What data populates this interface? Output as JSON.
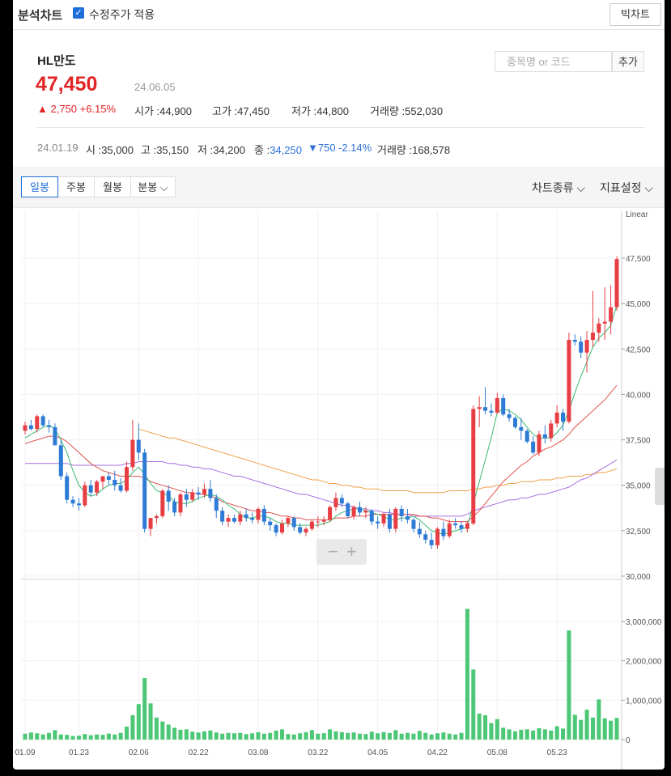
{
  "topbar": {
    "title": "분석차트",
    "adjusted_label": "수정주가 적용",
    "big_chart_label": "빅차트"
  },
  "stock": {
    "name": "HL만도",
    "price": "47,450",
    "date": "24.06.05",
    "change": "▲ 2,750  +6.15%",
    "open_label": "시가 :",
    "open": "44,900",
    "high_label": "고가 :",
    "high": "47,450",
    "low_label": "저가 :",
    "low": "44,800",
    "volume_label": "거래량 :",
    "volume": "552,030"
  },
  "search": {
    "placeholder": "종목명 or 코드",
    "add_label": "추가"
  },
  "hover": {
    "date": "24.01.19",
    "open_label": "시 :",
    "open": "35,000",
    "high_label": "고 :",
    "high": "35,150",
    "low_label": "저 :",
    "low": "34,200",
    "close_label": "종 :",
    "close": "34,250",
    "change": "▼750",
    "pct": "-2.14%",
    "volume_label": "거래량 :",
    "volume": "168,578"
  },
  "tabs": [
    "일봉",
    "주봉",
    "월봉",
    "분봉"
  ],
  "active_tab": "일봉",
  "selectors": {
    "chart_type": "차트종류",
    "indicator": "지표설정"
  },
  "colors": {
    "up": "#e63e44",
    "down": "#2d7bd6",
    "ma5": "#3cb971",
    "ma20": "#e05252",
    "ma60": "#a96ee0",
    "ma120": "#f0a24a",
    "volume": "#4bc775"
  },
  "chart_data": {
    "type": "candlestick",
    "scale_label": "Linear",
    "price_axis": {
      "min": 30000,
      "max": 47500,
      "ticks": [
        "30,000",
        "32,500",
        "35,000",
        "37,500",
        "40,000",
        "42,500",
        "45,000",
        "47,500"
      ]
    },
    "volume_axis": {
      "min": 0,
      "max": 3000000,
      "ticks": [
        "0",
        "1,000,000",
        "2,000,000",
        "3,000,000"
      ]
    },
    "x_ticks": [
      {
        "label": "01.09",
        "i": 0
      },
      {
        "label": "01.23",
        "i": 9
      },
      {
        "label": "02.06",
        "i": 19
      },
      {
        "label": "02.22",
        "i": 29
      },
      {
        "label": "03.08",
        "i": 39
      },
      {
        "label": "03.22",
        "i": 49
      },
      {
        "label": "04.05",
        "i": 59
      },
      {
        "label": "04.22",
        "i": 69
      },
      {
        "label": "05.08",
        "i": 79
      },
      {
        "label": "05.23",
        "i": 89
      }
    ],
    "candles": [
      [
        38000,
        38500,
        37800,
        38300
      ],
      [
        38300,
        38600,
        38000,
        38100
      ],
      [
        38100,
        38900,
        37900,
        38800
      ],
      [
        38800,
        38900,
        38200,
        38300
      ],
      [
        38300,
        38600,
        37900,
        38200
      ],
      [
        38200,
        38400,
        37200,
        37200
      ],
      [
        37200,
        37500,
        35300,
        35500
      ],
      [
        35500,
        35700,
        34000,
        34200
      ],
      [
        34200,
        34400,
        33800,
        34000
      ],
      [
        34000,
        34300,
        33600,
        33900
      ],
      [
        33900,
        35200,
        33800,
        35000
      ],
      [
        35000,
        35300,
        34400,
        34600
      ],
      [
        34600,
        35300,
        34400,
        35200
      ],
      [
        35200,
        35500,
        34800,
        35500
      ],
      [
        35500,
        35700,
        35000,
        35300
      ],
      [
        35300,
        35800,
        34700,
        35000
      ],
      [
        35000,
        35400,
        34600,
        34700
      ],
      [
        34700,
        36300,
        34600,
        36000
      ],
      [
        36000,
        38600,
        35800,
        37500
      ],
      [
        37500,
        38400,
        36400,
        36800
      ],
      [
        36800,
        37000,
        32400,
        32600
      ],
      [
        32600,
        33000,
        32200,
        33200
      ],
      [
        33200,
        33400,
        32900,
        33300
      ],
      [
        33300,
        34800,
        33200,
        34700
      ],
      [
        34700,
        35000,
        33600,
        34100
      ],
      [
        34100,
        34300,
        33300,
        33500
      ],
      [
        33500,
        34600,
        33300,
        34500
      ],
      [
        34500,
        34800,
        33800,
        34200
      ],
      [
        34200,
        34800,
        34100,
        34600
      ],
      [
        34600,
        34900,
        34200,
        34500
      ],
      [
        34500,
        35100,
        34300,
        34800
      ],
      [
        34800,
        35300,
        34100,
        34300
      ],
      [
        34300,
        34500,
        33200,
        33600
      ],
      [
        33600,
        33800,
        32800,
        33000
      ],
      [
        33000,
        33400,
        32700,
        33200
      ],
      [
        33200,
        33400,
        32900,
        33000
      ],
      [
        33000,
        33600,
        32800,
        33400
      ],
      [
        33400,
        33700,
        33000,
        33200
      ],
      [
        33200,
        33500,
        32900,
        33100
      ],
      [
        33100,
        33800,
        32900,
        33700
      ],
      [
        33700,
        33900,
        32800,
        33000
      ],
      [
        33000,
        33200,
        32500,
        32800
      ],
      [
        32800,
        32900,
        32200,
        32400
      ],
      [
        32400,
        33100,
        32300,
        32900
      ],
      [
        32900,
        33300,
        32700,
        33200
      ],
      [
        33200,
        33300,
        32500,
        32700
      ],
      [
        32700,
        32900,
        32300,
        32400
      ],
      [
        32400,
        32700,
        32200,
        32600
      ],
      [
        32600,
        33100,
        32500,
        33000
      ],
      [
        33000,
        33300,
        32700,
        33000
      ],
      [
        33000,
        33300,
        32800,
        33100
      ],
      [
        33100,
        33900,
        33000,
        33800
      ],
      [
        33800,
        34600,
        33600,
        34300
      ],
      [
        34300,
        34500,
        33800,
        34000
      ],
      [
        34000,
        34100,
        33200,
        33300
      ],
      [
        33300,
        33900,
        33100,
        33800
      ],
      [
        33800,
        34100,
        33300,
        33500
      ],
      [
        33500,
        33800,
        33200,
        33600
      ],
      [
        33600,
        33700,
        32800,
        33000
      ],
      [
        33000,
        33300,
        32600,
        32900
      ],
      [
        32900,
        33500,
        32700,
        33400
      ],
      [
        33400,
        33700,
        32400,
        32600
      ],
      [
        32600,
        33800,
        32400,
        33700
      ],
      [
        33700,
        33900,
        33000,
        33300
      ],
      [
        33300,
        33700,
        32900,
        33100
      ],
      [
        33100,
        33200,
        32400,
        32600
      ],
      [
        32600,
        33000,
        32100,
        32300
      ],
      [
        32300,
        32500,
        31800,
        32000
      ],
      [
        32000,
        32400,
        31500,
        31700
      ],
      [
        31700,
        32700,
        31500,
        32600
      ],
      [
        32600,
        33000,
        32000,
        32200
      ],
      [
        32200,
        33100,
        32100,
        32900
      ],
      [
        32900,
        33200,
        32600,
        32800
      ],
      [
        32800,
        33000,
        32400,
        32600
      ],
      [
        32600,
        33000,
        32400,
        32900
      ],
      [
        32900,
        39400,
        32800,
        39200
      ],
      [
        39200,
        39900,
        38200,
        39300
      ],
      [
        39300,
        40400,
        38900,
        39100
      ],
      [
        39100,
        39500,
        38800,
        39000
      ],
      [
        39000,
        40100,
        38900,
        39800
      ],
      [
        39800,
        40000,
        38800,
        38900
      ],
      [
        38900,
        39200,
        38500,
        38700
      ],
      [
        38700,
        38800,
        38100,
        38200
      ],
      [
        38200,
        38700,
        37500,
        38000
      ],
      [
        38000,
        38100,
        37300,
        37400
      ],
      [
        37400,
        37700,
        36700,
        36800
      ],
      [
        36800,
        38000,
        36600,
        37800
      ],
      [
        37800,
        38300,
        37300,
        37600
      ],
      [
        37600,
        38600,
        37400,
        38400
      ],
      [
        38400,
        39400,
        38200,
        39000
      ],
      [
        39000,
        39200,
        38000,
        38500
      ],
      [
        38500,
        43400,
        38400,
        43000
      ],
      [
        43000,
        43300,
        42700,
        42900
      ],
      [
        42900,
        43200,
        42000,
        42300
      ],
      [
        42300,
        43500,
        41200,
        43000
      ],
      [
        43000,
        45700,
        42600,
        43400
      ],
      [
        43400,
        44200,
        42900,
        43900
      ],
      [
        43900,
        45900,
        43000,
        44000
      ],
      [
        44000,
        46000,
        43300,
        44800
      ],
      [
        44800,
        47600,
        44600,
        47450
      ]
    ],
    "volumes": [
      150000,
      180000,
      160000,
      130000,
      170000,
      240000,
      130000,
      120000,
      90000,
      100000,
      140000,
      110000,
      130000,
      120000,
      150000,
      130000,
      170000,
      330000,
      620000,
      900000,
      1560000,
      920000,
      560000,
      460000,
      380000,
      300000,
      250000,
      260000,
      200000,
      180000,
      210000,
      230000,
      180000,
      150000,
      170000,
      160000,
      170000,
      140000,
      160000,
      190000,
      150000,
      170000,
      230000,
      260000,
      140000,
      130000,
      160000,
      190000,
      240000,
      150000,
      160000,
      260000,
      210000,
      190000,
      170000,
      180000,
      150000,
      140000,
      200000,
      160000,
      190000,
      170000,
      240000,
      150000,
      170000,
      150000,
      220000,
      170000,
      130000,
      160000,
      180000,
      150000,
      130000,
      170000,
      3320000,
      1780000,
      660000,
      620000,
      420000,
      520000,
      300000,
      260000,
      210000,
      250000,
      260000,
      230000,
      290000,
      260000,
      230000,
      340000,
      280000,
      2770000,
      630000,
      500000,
      760000,
      560000,
      1020000,
      540000,
      480000,
      552030
    ],
    "ma5": [
      37600,
      37800,
      38000,
      38200,
      38300,
      38100,
      37500,
      36800,
      35800,
      35000,
      34600,
      34400,
      34500,
      34800,
      35000,
      35100,
      35100,
      35300,
      35700,
      36000,
      35600,
      35100,
      34700,
      34600,
      34400,
      34100,
      34000,
      34000,
      34100,
      34300,
      34400,
      34500,
      34400,
      34200,
      33900,
      33700,
      33400,
      33200,
      33200,
      33300,
      33300,
      33200,
      33000,
      32900,
      32900,
      32800,
      32800,
      32800,
      32800,
      32800,
      32900,
      33000,
      33300,
      33500,
      33600,
      33700,
      33700,
      33600,
      33500,
      33400,
      33300,
      33100,
      33100,
      33200,
      33200,
      33300,
      33100,
      32800,
      32500,
      32400,
      32300,
      32400,
      32500,
      32600,
      32700,
      34000,
      35200,
      36400,
      37600,
      39000,
      39200,
      39100,
      38900,
      38600,
      38200,
      37800,
      37600,
      37600,
      37600,
      37900,
      38300,
      39100,
      40100,
      41000,
      41800,
      42600,
      43100,
      43400,
      43800,
      44900
    ],
    "ma20": [
      37300,
      37400,
      37500,
      37600,
      37700,
      37700,
      37600,
      37400,
      37100,
      36800,
      36500,
      36200,
      36000,
      35800,
      35700,
      35600,
      35500,
      35500,
      35500,
      35500,
      35400,
      35200,
      35100,
      35000,
      34900,
      34800,
      34700,
      34600,
      34600,
      34500,
      34500,
      34400,
      34300,
      34100,
      34000,
      33900,
      33800,
      33700,
      33600,
      33600,
      33500,
      33500,
      33400,
      33300,
      33300,
      33200,
      33200,
      33100,
      33100,
      33100,
      33100,
      33100,
      33200,
      33200,
      33200,
      33300,
      33300,
      33300,
      33400,
      33400,
      33400,
      33400,
      33400,
      33400,
      33400,
      33400,
      33300,
      33300,
      33200,
      33200,
      33100,
      33000,
      33000,
      33000,
      33000,
      33300,
      33600,
      34000,
      34400,
      34800,
      35200,
      35500,
      35800,
      36100,
      36300,
      36600,
      36800,
      37000,
      37100,
      37300,
      37500,
      37800,
      38200,
      38500,
      38800,
      39100,
      39400,
      39700,
      40100,
      40500
    ],
    "ma60": [
      36200,
      36200,
      36200,
      36200,
      36200,
      36200,
      36200,
      36200,
      36100,
      36100,
      36100,
      36100,
      36100,
      36100,
      36100,
      36100,
      36100,
      36200,
      36200,
      36300,
      36300,
      36300,
      36300,
      36300,
      36200,
      36200,
      36100,
      36100,
      36000,
      36000,
      35900,
      35900,
      35800,
      35700,
      35600,
      35500,
      35500,
      35400,
      35300,
      35200,
      35100,
      35000,
      34900,
      34800,
      34700,
      34600,
      34500,
      34500,
      34400,
      34300,
      34200,
      34100,
      34000,
      33900,
      33900,
      33800,
      33700,
      33700,
      33600,
      33600,
      33500,
      33500,
      33400,
      33400,
      33400,
      33300,
      33300,
      33300,
      33300,
      33300,
      33300,
      33300,
      33300,
      33300,
      33400,
      33600,
      33700,
      33800,
      33900,
      34000,
      34100,
      34200,
      34200,
      34300,
      34300,
      34400,
      34500,
      34500,
      34600,
      34700,
      34800,
      34900,
      35100,
      35300,
      35400,
      35600,
      35800,
      36000,
      36200,
      36400
    ],
    "ma120": [
      null,
      null,
      null,
      null,
      null,
      null,
      null,
      null,
      null,
      null,
      null,
      null,
      null,
      null,
      null,
      null,
      null,
      null,
      null,
      38100,
      38000,
      37900,
      37800,
      37700,
      37600,
      37600,
      37500,
      37400,
      37300,
      37200,
      37100,
      37000,
      36900,
      36800,
      36700,
      36600,
      36500,
      36400,
      36300,
      36200,
      36100,
      36000,
      35900,
      35800,
      35700,
      35600,
      35500,
      35400,
      35300,
      35300,
      35200,
      35100,
      35100,
      35000,
      35000,
      34900,
      34900,
      34800,
      34800,
      34800,
      34700,
      34700,
      34700,
      34700,
      34700,
      34600,
      34600,
      34600,
      34600,
      34600,
      34600,
      34700,
      34700,
      34700,
      34700,
      34800,
      34800,
      34900,
      34900,
      35000,
      35000,
      35100,
      35100,
      35200,
      35200,
      35200,
      35300,
      35300,
      35300,
      35400,
      35400,
      35500,
      35500,
      35500,
      35600,
      35600,
      35700,
      35700,
      35800,
      35900
    ]
  }
}
